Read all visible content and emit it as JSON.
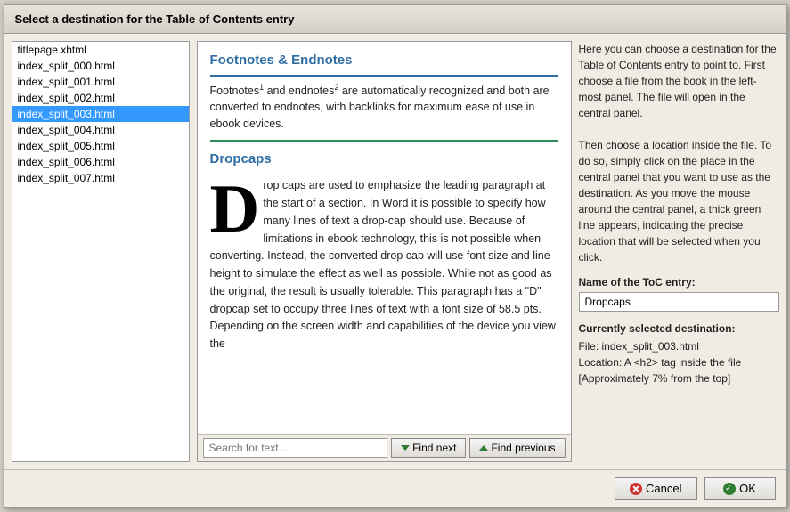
{
  "dialog": {
    "title": "Select a destination for the Table of Contents entry",
    "files": [
      {
        "name": "titlepage.xhtml",
        "selected": false
      },
      {
        "name": "index_split_000.html",
        "selected": false
      },
      {
        "name": "index_split_001.html",
        "selected": false
      },
      {
        "name": "index_split_002.html",
        "selected": false
      },
      {
        "name": "index_split_003.html",
        "selected": true
      },
      {
        "name": "index_split_004.html",
        "selected": false
      },
      {
        "name": "index_split_005.html",
        "selected": false
      },
      {
        "name": "index_split_006.html",
        "selected": false
      },
      {
        "name": "index_split_007.html",
        "selected": false
      }
    ],
    "content": {
      "section1_heading": "Footnotes & Endnotes",
      "section1_text": "Footnotes and endnotes are automatically recognized and both are converted to endnotes, with backlinks for maximum ease of use in ebook devices.",
      "section2_heading": "Dropcaps",
      "dropcap_letter": "D",
      "dropcap_text": "rop caps are used to emphasize the leading paragraph at the start of a section. In Word it is possible to specify how many lines of text a drop-cap should use. Because of limitations in ebook technology, this is not possible when converting. Instead, the converted drop cap will use font size and line height to simulate the effect as well as possible. While not as good as the original, the result is usually tolerable. This paragraph has a \"D\" dropcap set to occupy three lines of text with a font size of 58.5 pts. Depending on the screen width and capabilities of the device you view the"
    },
    "search": {
      "placeholder": "Search for text...",
      "find_next_label": "Find next",
      "find_previous_label": "Find previous"
    },
    "right_panel": {
      "description": "Here you can choose a destination for the Table of Contents entry to point to. First choose a file from the book in the left-most panel. The file will open in the central panel.\n\nThen choose a location inside the file. To do so, simply click on the place in the central panel that you want to use as the destination. As you move the mouse around the central panel, a thick green line appears, indicating the precise location that will be selected when you click.",
      "toc_entry_label": "Name of the ToC entry:",
      "toc_entry_value": "Dropcaps",
      "selected_dest_label": "Currently selected destination:",
      "selected_dest_file": "File: index_split_003.html",
      "selected_dest_location": "Location: A <h2> tag inside the file",
      "selected_dest_approx": "[Approximately 7% from the top]"
    },
    "footer": {
      "cancel_label": "Cancel",
      "ok_label": "OK"
    }
  }
}
